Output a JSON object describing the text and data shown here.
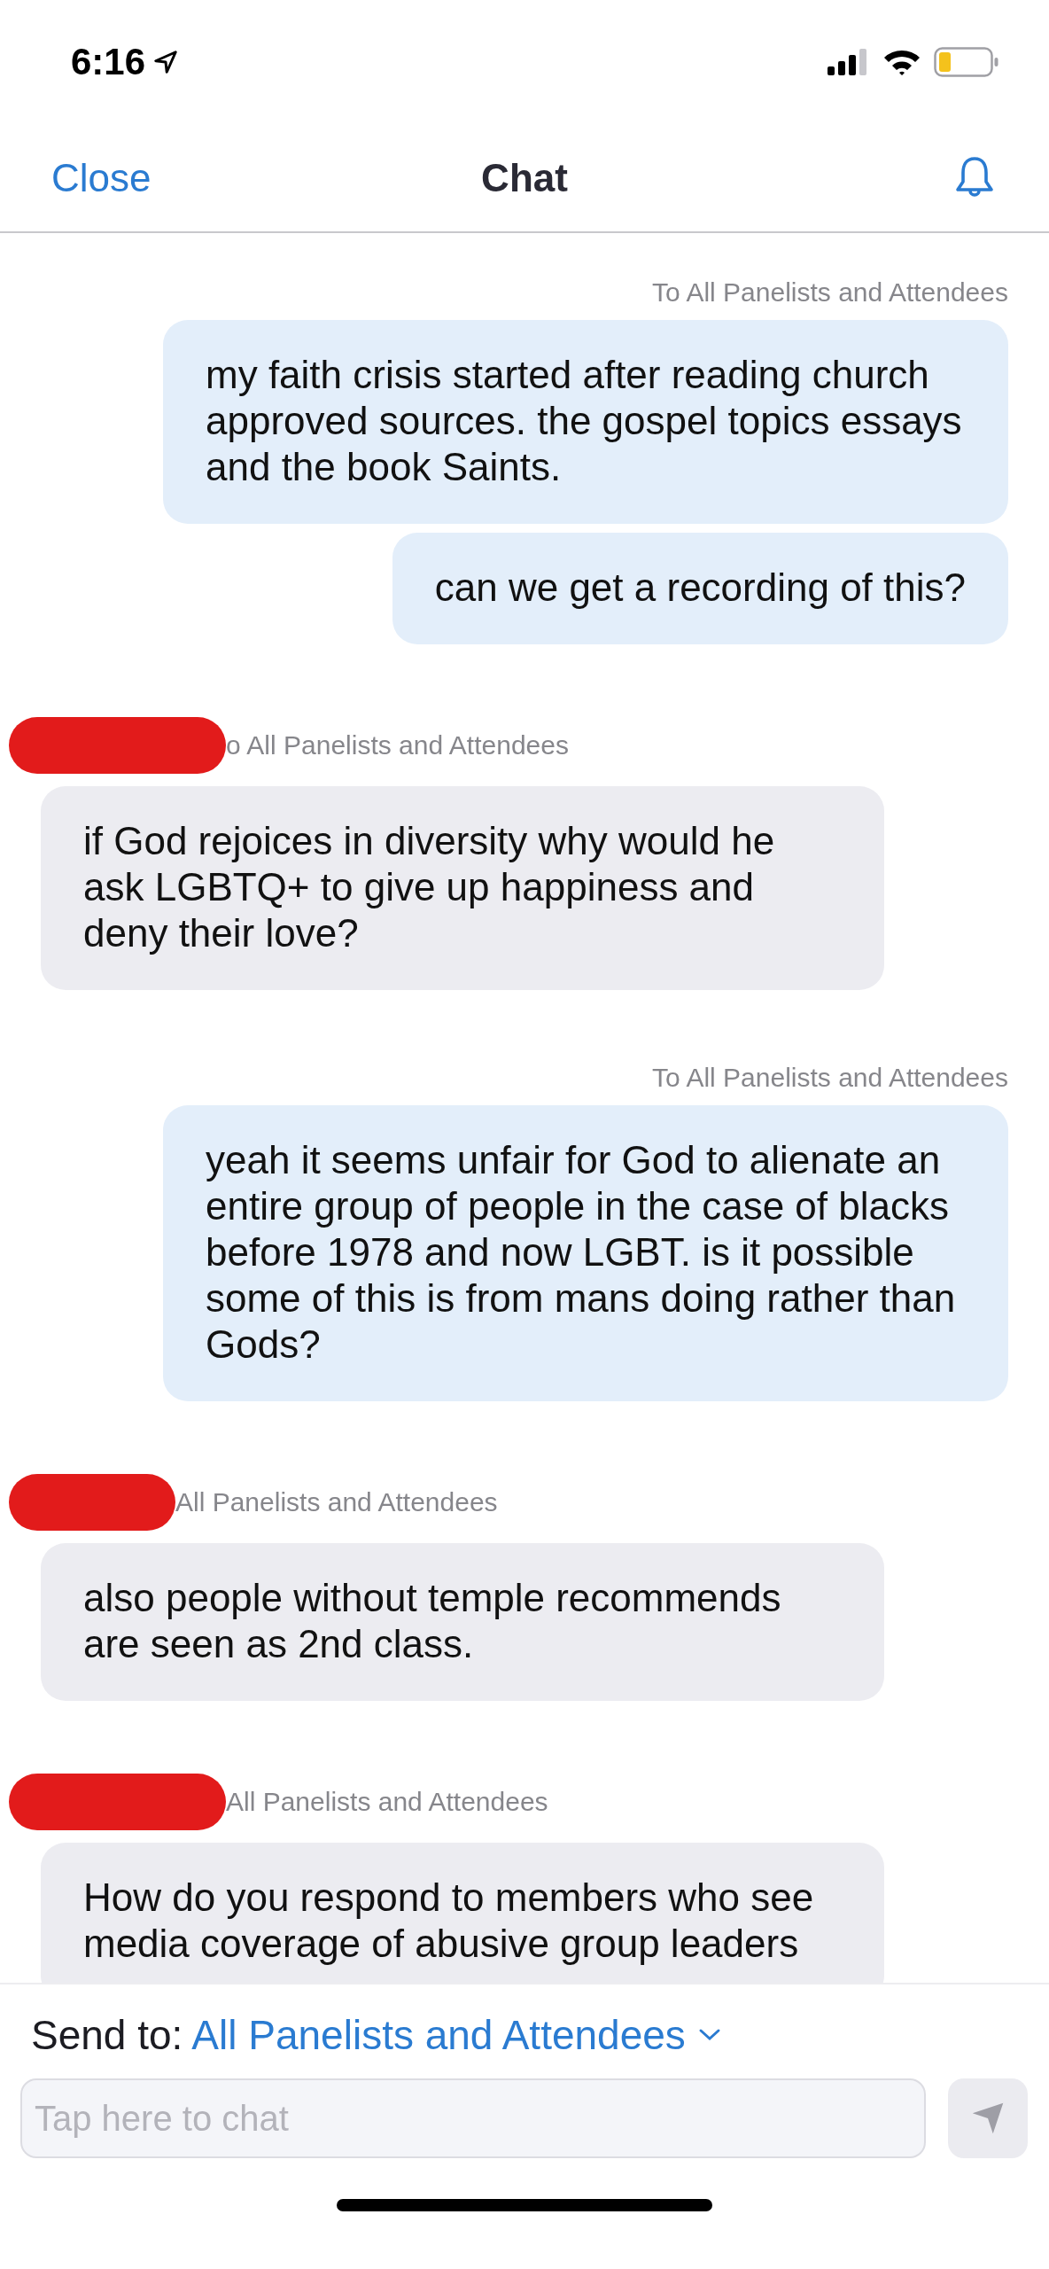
{
  "status_bar": {
    "time": "6:16"
  },
  "nav": {
    "close": "Close",
    "title": "Chat"
  },
  "messages": [
    {
      "kind": "sent",
      "recipient": "To All Panelists and Attendees",
      "text": "my faith crisis started after reading church approved sources. the gospel topics essays and the book Saints."
    },
    {
      "kind": "sent",
      "text": "can we get a recording of this?"
    },
    {
      "kind": "received",
      "redacted": true,
      "recipient": "o All Panelists and Attendees",
      "text": "if God rejoices in diversity why would he ask LGBTQ+ to give up happiness and deny their love?"
    },
    {
      "kind": "sent",
      "recipient": "To All Panelists and Attendees",
      "text": "yeah it seems unfair for God to alienate an entire group of people in the case of blacks before 1978 and now LGBT. is it possible some of this is from mans doing rather than Gods?"
    },
    {
      "kind": "received",
      "redacted": true,
      "recipient": "All Panelists and Attendees",
      "text": "also people without temple recommends are seen as 2nd class."
    },
    {
      "kind": "received",
      "redacted": true,
      "recipient": "All Panelists and Attendees",
      "text": "How do you respond to members who see media coverage of abusive group leaders"
    }
  ],
  "composer": {
    "send_to_label": "Send to:",
    "send_to_value": "All Panelists and Attendees",
    "placeholder": "Tap here to chat",
    "send_disabled": true
  }
}
